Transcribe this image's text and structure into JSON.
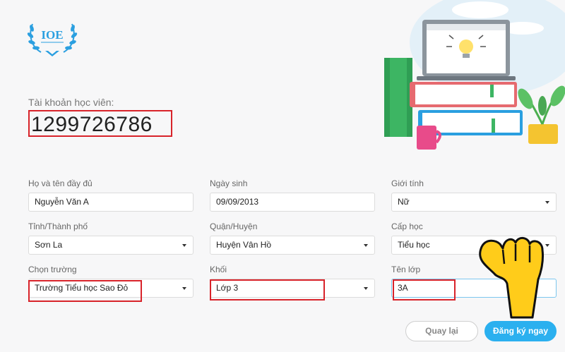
{
  "logo": {
    "text": "IOE"
  },
  "account": {
    "label": "Tài khoản học viên:",
    "number": "1299726786"
  },
  "form": {
    "fullname": {
      "label": "Họ và tên đầy đủ",
      "value": "Nguyễn Văn A"
    },
    "dob": {
      "label": "Ngày sinh",
      "value": "09/09/2013"
    },
    "gender": {
      "label": "Giới tính",
      "value": "Nữ"
    },
    "province": {
      "label": "Tỉnh/Thành phố",
      "value": "Sơn La"
    },
    "district": {
      "label": "Quận/Huyện",
      "value": "Huyện Vân Hồ"
    },
    "level": {
      "label": "Cấp học",
      "value": "Tiểu học"
    },
    "school": {
      "label": "Chọn trường",
      "value": "Trường Tiểu học Sao Đỏ"
    },
    "grade": {
      "label": "Khối",
      "value": "Lớp 3"
    },
    "classname": {
      "label": "Tên lớp",
      "value": "3A"
    }
  },
  "buttons": {
    "back": "Quay lại",
    "register": "Đăng ký ngay"
  },
  "colors": {
    "highlight": "#d8232a",
    "primary": "#2bb0ef",
    "background": "#f7f7f8"
  }
}
